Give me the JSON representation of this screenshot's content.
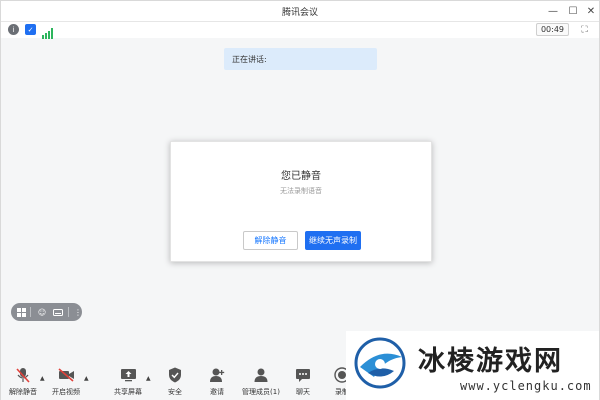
{
  "window": {
    "title": "腾讯会议"
  },
  "status": {
    "timer": "00:49"
  },
  "speaking": {
    "label": "正在讲话:"
  },
  "dialog": {
    "title": "您已静音",
    "subtitle": "无法录制语音",
    "unmute_button": "解除静音",
    "continue_button": "继续无声录制"
  },
  "toolbar": {
    "unmute": "解除静音",
    "video": "开启视频",
    "share": "共享屏幕",
    "security": "安全",
    "invite": "邀请",
    "members": "管理成员(1)",
    "chat": "聊天",
    "record": "录制"
  },
  "watermark": {
    "text": "冰棱游戏网",
    "url": "www.yclengku.com"
  },
  "colors": {
    "accent": "#1f6ff1",
    "banner": "#dcebfb",
    "muted_red": "#e0413a",
    "signal_green": "#2db55d"
  }
}
